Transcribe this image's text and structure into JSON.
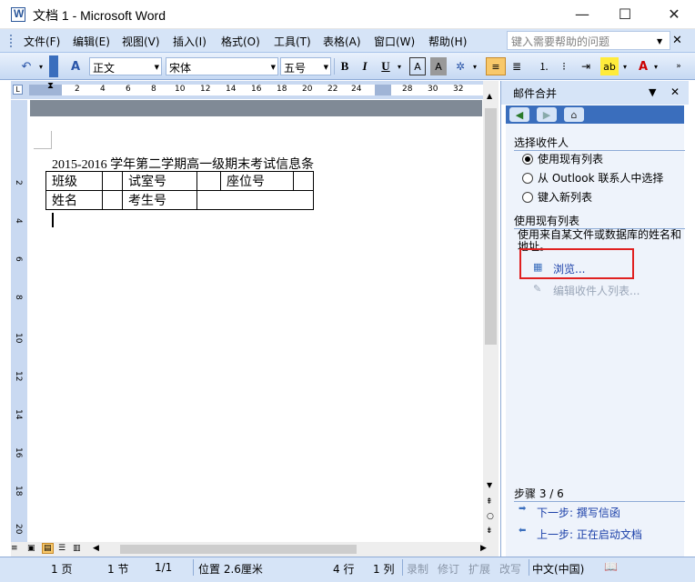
{
  "window": {
    "title": "文档 1 - Microsoft Word",
    "minimize": "—",
    "maximize": "☐",
    "close": "✕"
  },
  "menu": {
    "items": [
      "文件(F)",
      "编辑(E)",
      "视图(V)",
      "插入(I)",
      "格式(O)",
      "工具(T)",
      "表格(A)",
      "窗口(W)",
      "帮助(H)"
    ],
    "help_placeholder": "键入需要帮助的问题"
  },
  "toolbar": {
    "style": "正文",
    "font": "宋体",
    "size": "五号",
    "bold": "B",
    "italic": "I",
    "underline": "U",
    "font_color": "A"
  },
  "ruler": {
    "ticks": [
      "2",
      "4",
      "6",
      "8",
      "10",
      "12",
      "14",
      "16",
      "18",
      "20",
      "22",
      "24",
      "28",
      "30",
      "32"
    ],
    "vticks": [
      "2",
      "4",
      "6",
      "8",
      "10",
      "12",
      "14",
      "16",
      "18",
      "20"
    ]
  },
  "document": {
    "title": "2015-2016 学年第二学期高一级期末考试信息条",
    "table": [
      [
        "班级",
        "",
        "试室号",
        "",
        "座位号",
        ""
      ],
      [
        "姓名",
        "",
        "考生号",
        "",
        "",
        ""
      ]
    ]
  },
  "taskpane": {
    "title": "邮件合并",
    "section1": "选择收件人",
    "options": [
      {
        "label": "使用现有列表",
        "selected": true
      },
      {
        "label": "从 Outlook 联系人中选择",
        "selected": false
      },
      {
        "label": "键入新列表",
        "selected": false
      }
    ],
    "section2": "使用现有列表",
    "description": "使用来自某文件或数据库的姓名和地址。",
    "browse": "浏览...",
    "edit_list": "编辑收件人列表...",
    "step": "步骤 3 / 6",
    "next": "下一步: 撰写信函",
    "prev": "上一步: 正在启动文档"
  },
  "status": {
    "page": "1 页",
    "section": "1 节",
    "pages": "1/1",
    "position": "位置 2.6厘米",
    "line": "4 行",
    "column": "1 列",
    "rec": "录制",
    "trk": "修订",
    "ext": "扩展",
    "ovr": "改写",
    "lang": "中文(中国)"
  },
  "colors": {
    "menubar": "#d6e4f7",
    "accent": "#3a6ebd",
    "highlight": "#e02020"
  }
}
